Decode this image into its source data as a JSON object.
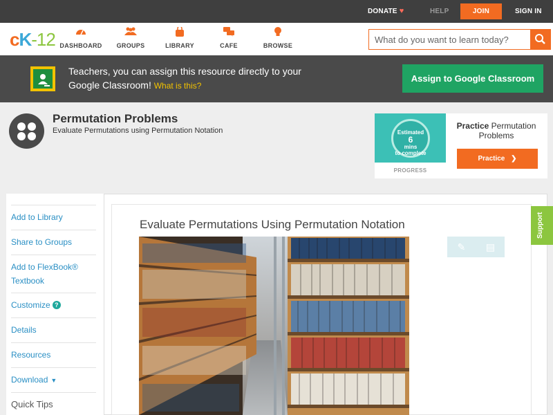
{
  "topbar": {
    "donate": "DONATE",
    "help": "HELP",
    "join": "JOIN",
    "signin": "SIGN IN"
  },
  "logo": {
    "c": "c",
    "k": "K",
    "dash": "-",
    "n": "12"
  },
  "nav": [
    {
      "label": "DASHBOARD",
      "icon": "dashboard-gauge-icon"
    },
    {
      "label": "GROUPS",
      "icon": "groups-people-icon"
    },
    {
      "label": "LIBRARY",
      "icon": "library-bag-icon"
    },
    {
      "label": "CAFE",
      "icon": "cafe-chat-icon"
    },
    {
      "label": "BROWSE",
      "icon": "browse-lightbulb-icon"
    }
  ],
  "search": {
    "placeholder": "What do you want to learn today?"
  },
  "banner": {
    "message": "Teachers, you can assign this resource directly to your Google Classroom!",
    "what": "What is this?",
    "button": "Assign to Google Classroom"
  },
  "header": {
    "title": "Permutation Problems",
    "subtitle": "Evaluate Permutations using Permutation Notation"
  },
  "practice_card": {
    "estimate_line1": "Estimated",
    "estimate_mins": "6",
    "estimate_line2": "mins",
    "estimate_line3": "to complete",
    "progress": "PROGRESS",
    "title_bold": "Practice",
    "title_rest": "Permutation Problems",
    "button": "Practice"
  },
  "sidebar": {
    "items": [
      {
        "label": "Add to Library"
      },
      {
        "label": "Share to Groups"
      },
      {
        "label": "Add to FlexBook® Textbook"
      },
      {
        "label": "Customize"
      },
      {
        "label": "Details"
      },
      {
        "label": "Resources"
      },
      {
        "label": "Download"
      },
      {
        "label": "Quick Tips"
      }
    ],
    "help_glyph": "?"
  },
  "content": {
    "title": "Evaluate Permutations Using Permutation Notation"
  },
  "support": "Support",
  "colors": {
    "accent": "#f26b21",
    "classroom_green": "#1fa463",
    "link_blue": "#2a8fc4",
    "support_green": "#8cc63f"
  }
}
